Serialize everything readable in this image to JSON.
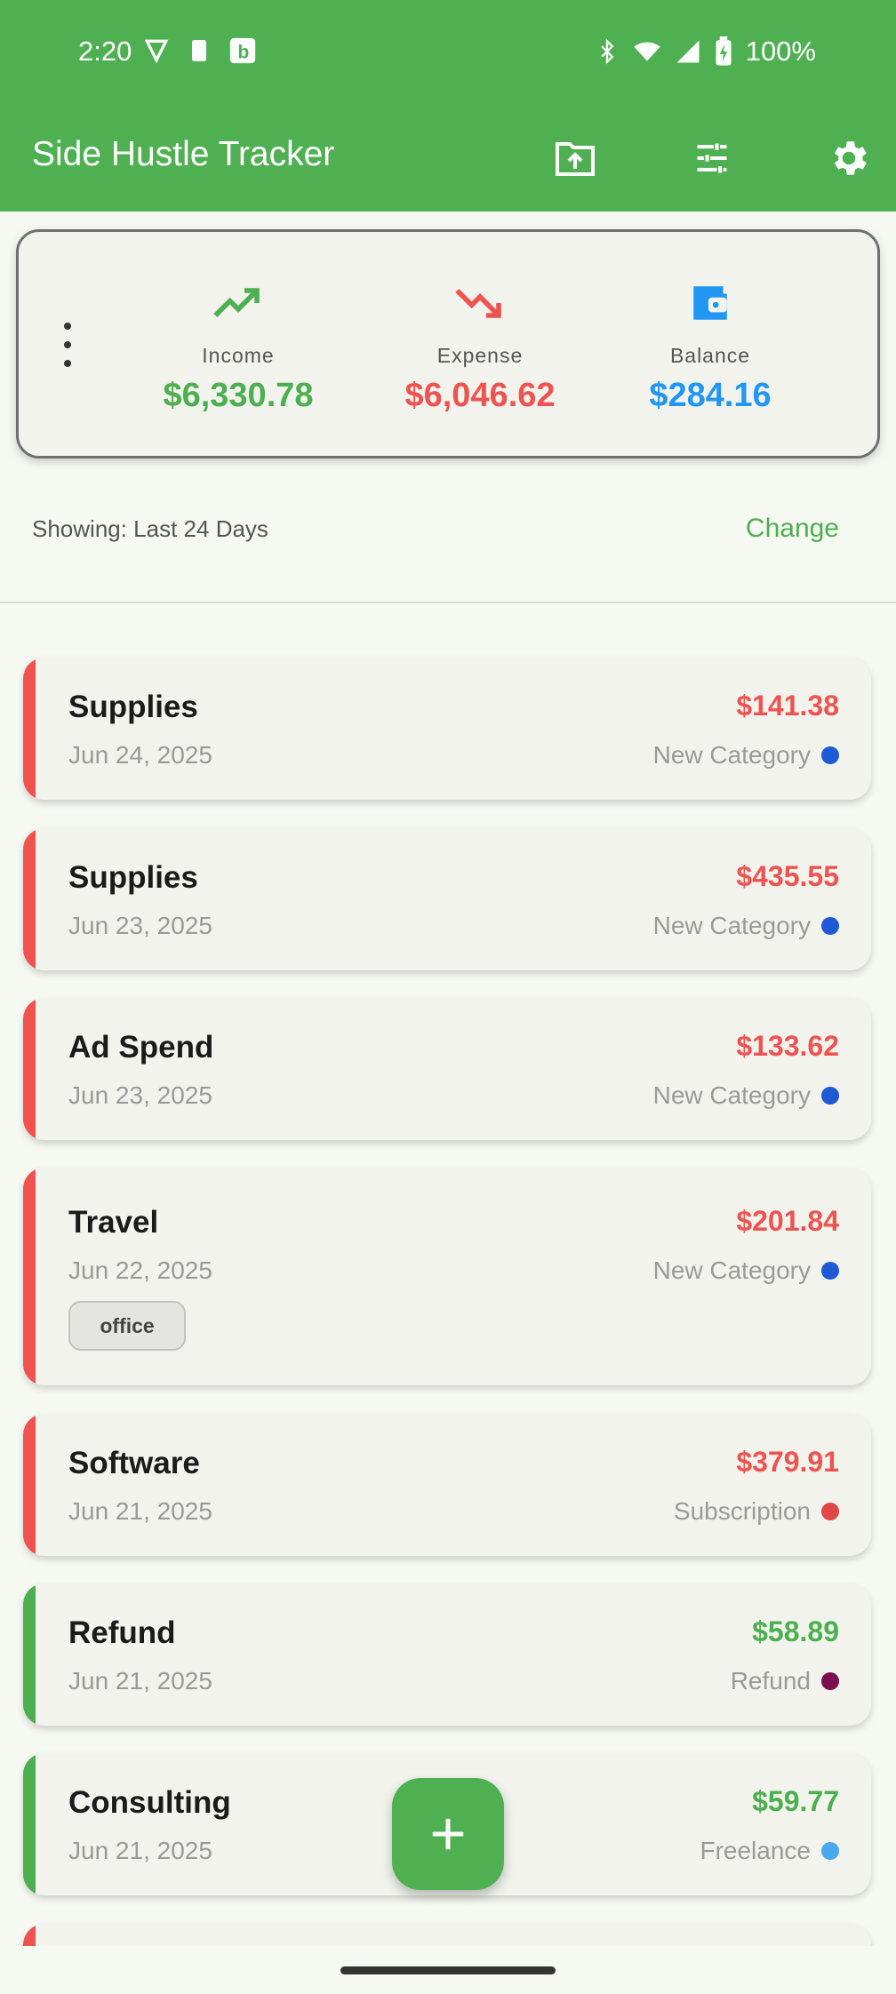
{
  "status_bar": {
    "time": "2:20",
    "battery": "100%"
  },
  "app_bar": {
    "title": "Side Hustle Tracker",
    "actions": [
      "upload-folder-icon",
      "tune-icon",
      "settings-gear-icon"
    ]
  },
  "summary": {
    "income_label": "Income",
    "income_value": "$6,330.78",
    "expense_label": "Expense",
    "expense_value": "$6,046.62",
    "balance_label": "Balance",
    "balance_value": "$284.16"
  },
  "filter": {
    "showing": "Showing: Last 24 Days",
    "change": "Change"
  },
  "transactions": [
    {
      "title": "Supplies",
      "date": "Jun 24, 2025",
      "amount": "$141.38",
      "category": "New Category",
      "type": "expense",
      "dot_color": "#1E5AD6"
    },
    {
      "title": "Supplies",
      "date": "Jun 23, 2025",
      "amount": "$435.55",
      "category": "New Category",
      "type": "expense",
      "dot_color": "#1E5AD6"
    },
    {
      "title": "Ad Spend",
      "date": "Jun 23, 2025",
      "amount": "$133.62",
      "category": "New Category",
      "type": "expense",
      "dot_color": "#1E5AD6"
    },
    {
      "title": "Travel",
      "date": "Jun 22, 2025",
      "amount": "$201.84",
      "category": "New Category",
      "type": "expense",
      "dot_color": "#1E5AD6",
      "tag": "office"
    },
    {
      "title": "Software",
      "date": "Jun 21, 2025",
      "amount": "$379.91",
      "category": "Subscription",
      "type": "expense",
      "dot_color": "#E04848"
    },
    {
      "title": "Refund",
      "date": "Jun 21, 2025",
      "amount": "$58.89",
      "category": "Refund",
      "type": "income",
      "dot_color": "#7A0E4E"
    },
    {
      "title": "Consulting",
      "date": "Jun 21, 2025",
      "amount": "$59.77",
      "category": "Freelance",
      "type": "income",
      "dot_color": "#4AA8F0"
    }
  ],
  "fab": {
    "icon": "plus-icon"
  }
}
